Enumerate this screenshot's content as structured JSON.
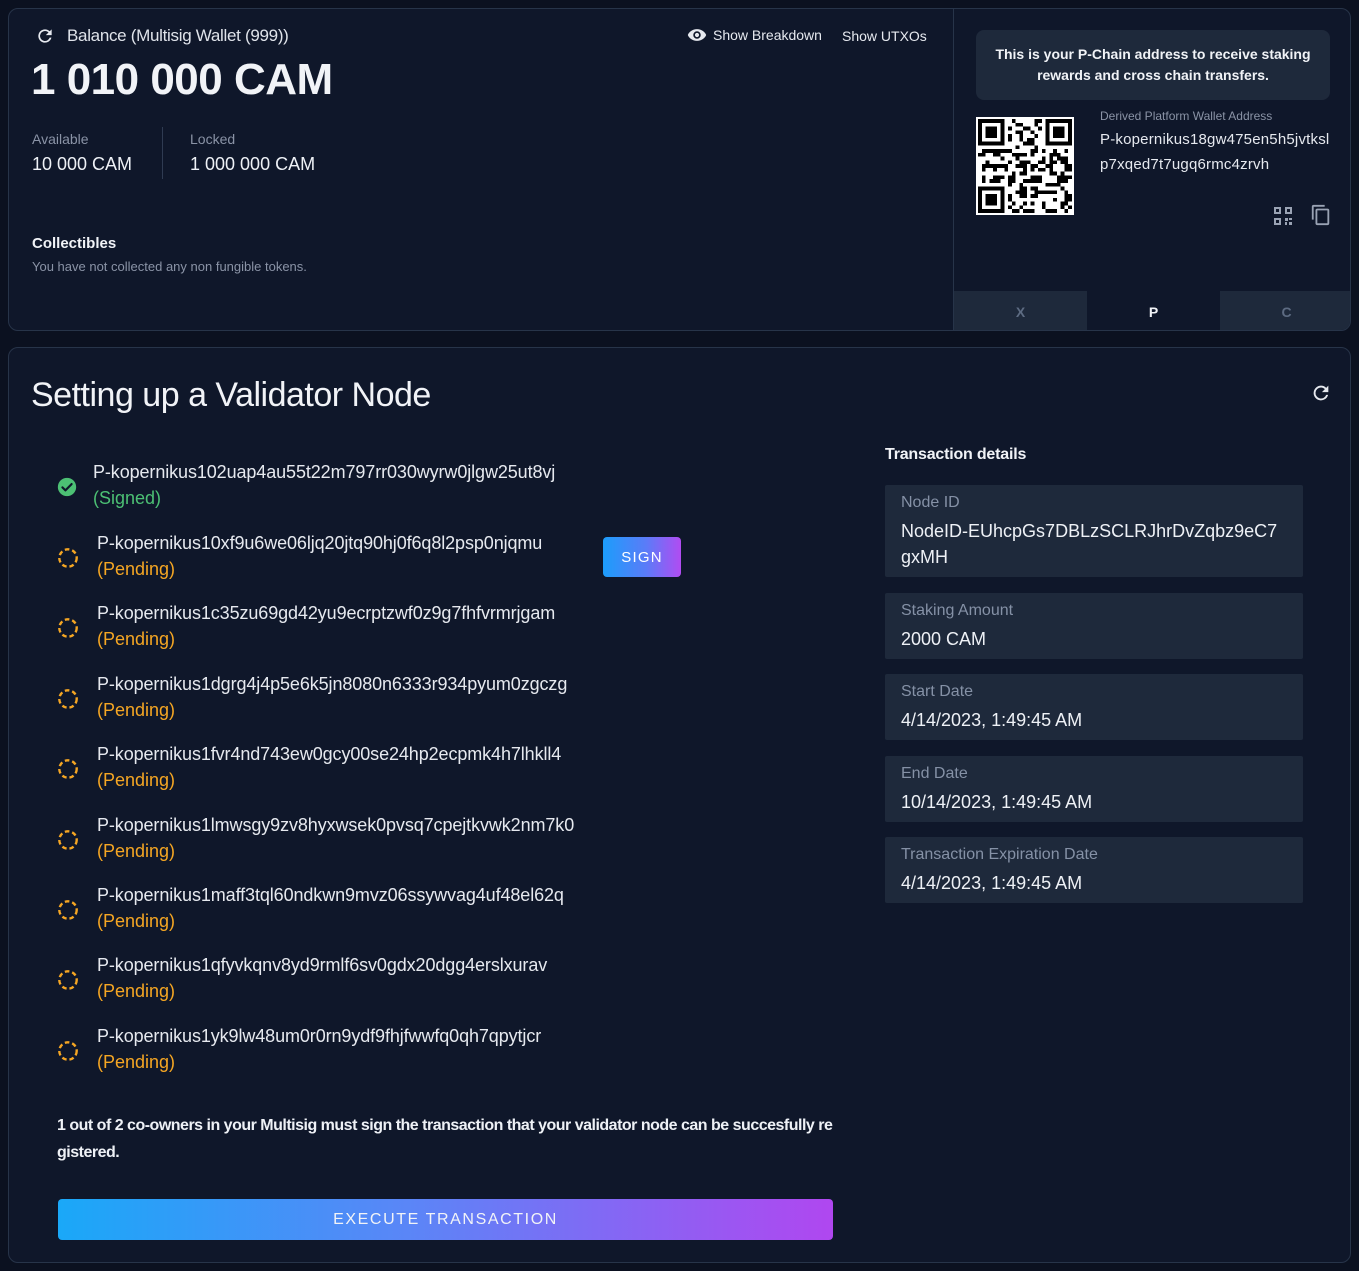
{
  "balance": {
    "title": "Balance (Multisig Wallet (999))",
    "amount": "1 010 000 CAM",
    "available_label": "Available",
    "available_value": "10 000 CAM",
    "locked_label": "Locked",
    "locked_value": "1 000 000 CAM",
    "show_breakdown": "Show Breakdown",
    "show_utxos": "Show UTXOs"
  },
  "collectibles": {
    "title": "Collectibles",
    "empty_text": "You have not collected any non fungible tokens."
  },
  "address_panel": {
    "info": "This is your P-Chain address to receive staking rewards and cross chain transfers.",
    "label": "Derived Platform Wallet Address",
    "address": "P-kopernikus18gw475en5h5jvtkslp7xqed7t7ugq6rmc4zrvh",
    "chain_tabs": [
      "X",
      "P",
      "C"
    ],
    "active_tab": "P"
  },
  "validator": {
    "title": "Setting up a Validator Node",
    "signers": [
      {
        "address": "P-kopernikus102uap4au55t22m797rr030wyrw0jlgw25ut8vj",
        "status": "(Signed)"
      },
      {
        "address": "P-kopernikus10xf9u6we06ljq20jtq90hj0f6q8l2psp0njqmu",
        "status": "(Pending)"
      },
      {
        "address": "P-kopernikus1c35zu69gd42yu9ecrptzwf0z9g7fhfvrmrjgam",
        "status": "(Pending)"
      },
      {
        "address": "P-kopernikus1dgrg4j4p5e6k5jn8080n6333r934pyum0zgczg",
        "status": "(Pending)"
      },
      {
        "address": "P-kopernikus1fvr4nd743ew0gcy00se24hp2ecpmk4h7lhkll4",
        "status": "(Pending)"
      },
      {
        "address": "P-kopernikus1lmwsgy9zv8hyxwsek0pvsq7cpejtkvwk2nm7k0",
        "status": "(Pending)"
      },
      {
        "address": "P-kopernikus1maff3tql60ndkwn9mvz06ssywvag4uf48el62q",
        "status": "(Pending)"
      },
      {
        "address": "P-kopernikus1qfyvkqnv8yd9rmlf6sv0gdx20dgg4erslxurav",
        "status": "(Pending)"
      },
      {
        "address": "P-kopernikus1yk9lw48um0r0rn9ydf9fhjfwwfq0qh7qpytjcr",
        "status": "(Pending)"
      }
    ],
    "sign_label": "SIGN",
    "cosign_note": "1 out of 2 co-owners in your Multisig must sign the transaction that your validator node can be succesfully registered.",
    "execute_label": "EXECUTE TRANSACTION"
  },
  "tx_details": {
    "title": "Transaction details",
    "items": [
      {
        "label": "Node ID",
        "value": "NodeID-EUhcpGs7DBLzSCLRJhrDvZqbz9eC7gxMH"
      },
      {
        "label": "Staking Amount",
        "value": "2000 CAM"
      },
      {
        "label": "Start Date",
        "value": "4/14/2023, 1:49:45 AM"
      },
      {
        "label": "End Date",
        "value": "10/14/2023, 1:49:45 AM"
      },
      {
        "label": "Transaction Expiration Date",
        "value": "4/14/2023, 1:49:45 AM"
      }
    ]
  },
  "colors": {
    "background": "#0f172a",
    "panel": "#1e293b",
    "pending": "#f5a623",
    "signed": "#4cc074",
    "gradient_start": "#1c9dfb",
    "gradient_end": "#b14cf2"
  },
  "icons": {
    "refresh": "refresh-icon",
    "eye": "eye-icon",
    "copy": "copy-icon",
    "qr": "qr-code-icon",
    "signed": "check-circle-icon",
    "pending": "pending-circle-icon"
  }
}
